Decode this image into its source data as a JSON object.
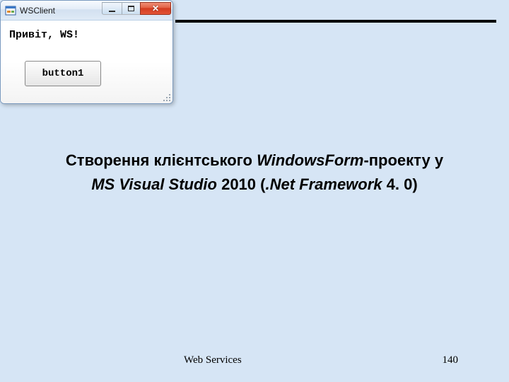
{
  "window": {
    "title": "WSClient",
    "label": "Привіт, WS!",
    "button_label": "button1"
  },
  "heading": {
    "part1": "Cтворення клієнтського ",
    "part2_italic": "WindowsForm",
    "part3": "-проекту у",
    "part4_italic": "MS Visual Studio",
    "part5": " 2010 (",
    "part6_italic": ".Net Framework",
    "part7": " 4. 0)"
  },
  "footer": {
    "text": "Web Services",
    "page": "140"
  }
}
